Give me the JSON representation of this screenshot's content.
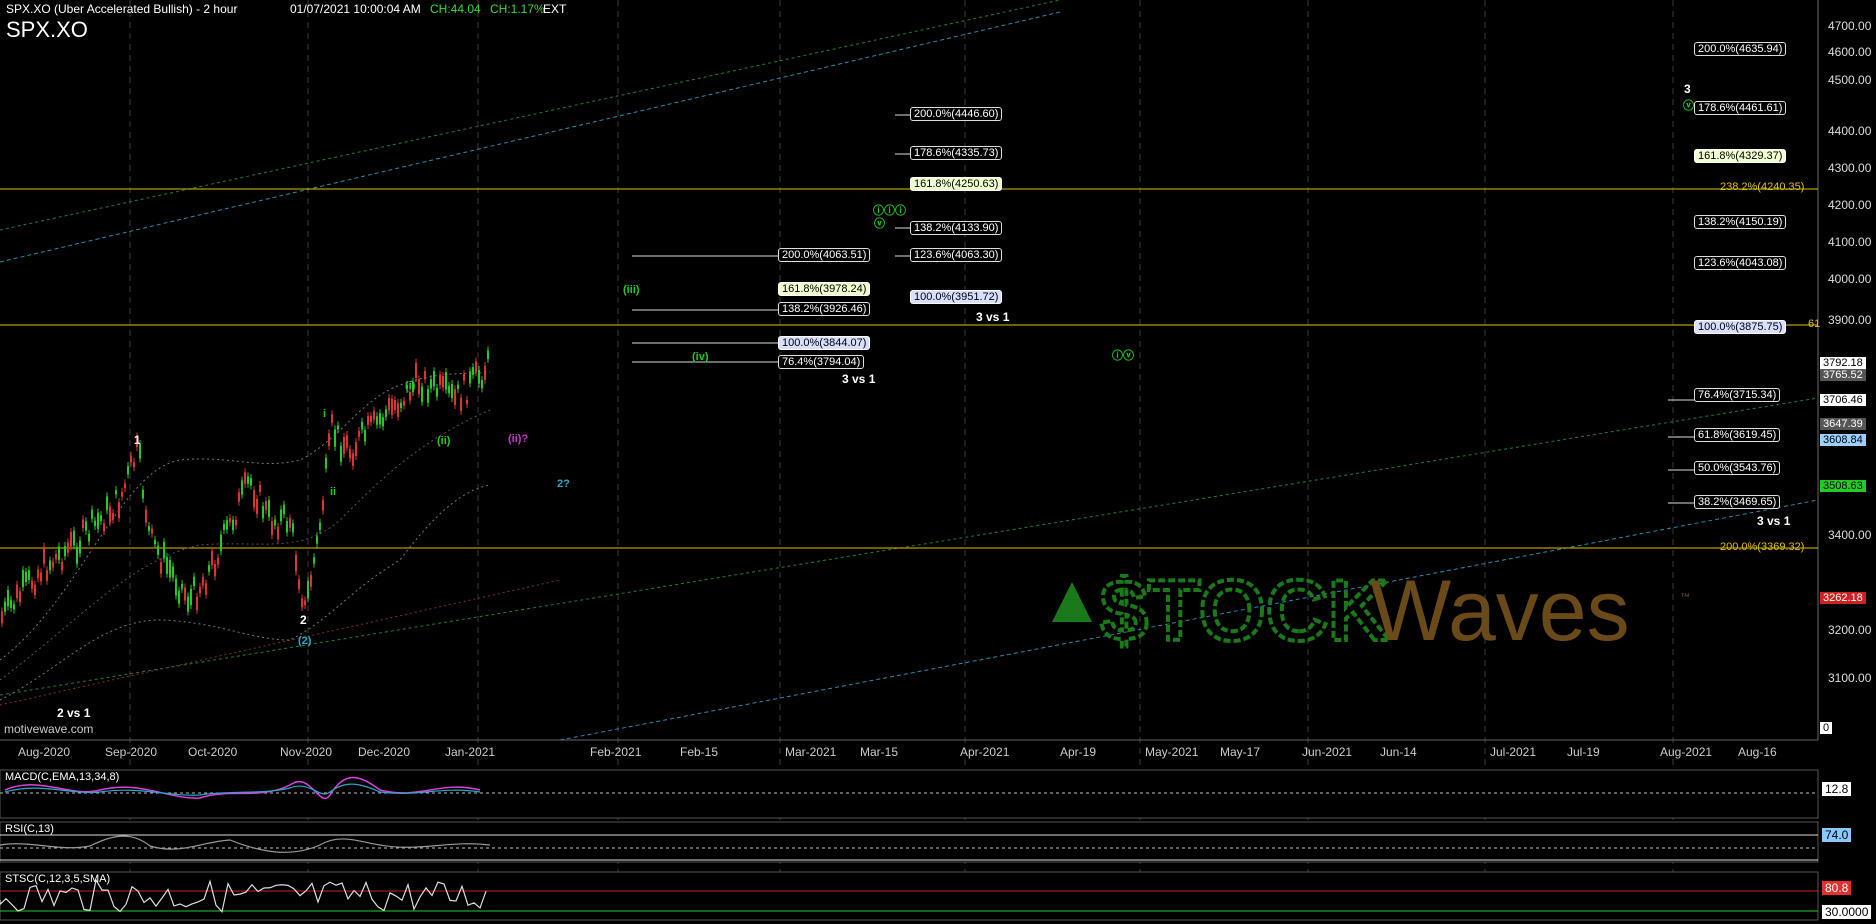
{
  "header": {
    "symbol_large": "SPX.XO",
    "title": "SPX.XO (Uber Accelerated Bullish) - 2 hour",
    "datetime": "01/07/2021 10:00:04 AM",
    "change_points": "CH:44.04",
    "change_pct": "CH:1.17%",
    "session": "EXT"
  },
  "watermark": {
    "text": "motivewave.com"
  },
  "logo": {
    "part1": "$TOCK",
    "part2": "Waves",
    "tm": "™"
  },
  "colors": {
    "grid": "#3a3a3a",
    "yellow": "#e0c000",
    "green": "#22cc22",
    "white": "#ffffff",
    "cyan": "#29a8c8",
    "magenta": "#cc33cc",
    "bg": "#000000"
  },
  "price_axis": {
    "ticks": [
      "4700.00",
      "4600.00",
      "4500.00",
      "4400.00",
      "4300.00",
      "4200.00",
      "4100.00",
      "4000.00",
      "3900.00",
      "3400.00",
      "3200.00",
      "3100.00"
    ],
    "badges": [
      {
        "label": "3792.18",
        "style": "white"
      },
      {
        "label": "3765.52",
        "style": "gray"
      },
      {
        "label": "3706.46",
        "style": "white"
      },
      {
        "label": "3647.39",
        "style": "gray"
      },
      {
        "label": "3608.84",
        "style": "blue"
      },
      {
        "label": "3508.63",
        "style": "green"
      },
      {
        "label": "3262.18",
        "style": "red"
      },
      {
        "label": "0",
        "style": "white"
      }
    ]
  },
  "time_axis": {
    "labels": [
      "Aug-2020",
      "Sep-2020",
      "Oct-2020",
      "Nov-2020",
      "Dec-2020",
      "Jan-2021",
      "Feb-2021",
      "Feb-15",
      "Mar-2021",
      "Mar-15",
      "Apr-2021",
      "Apr-19",
      "May-2021",
      "May-17",
      "Jun-2021",
      "Jun-14",
      "Jul-2021",
      "Jul-19",
      "Aug-2021",
      "Aug-16"
    ]
  },
  "fib_boxes_1": [
    {
      "label": "200.0%(4063.51)",
      "style": "white"
    },
    {
      "label": "161.8%(3978.24)",
      "style": "green"
    },
    {
      "label": "138.2%(3926.46)",
      "style": "white"
    },
    {
      "label": "100.0%(3844.07)",
      "style": "blue"
    },
    {
      "label": "76.4%(3794.04)",
      "style": "white"
    }
  ],
  "fib_boxes_2": [
    {
      "label": "200.0%(4446.60)",
      "style": "white"
    },
    {
      "label": "178.6%(4335.73)",
      "style": "white"
    },
    {
      "label": "161.8%(4250.63)",
      "style": "green"
    },
    {
      "label": "138.2%(4133.90)",
      "style": "white"
    },
    {
      "label": "123.6%(4063.30)",
      "style": "white"
    },
    {
      "label": "100.0%(3951.72)",
      "style": "blue"
    }
  ],
  "fib_boxes_3": [
    {
      "label": "200.0%(4635.94)",
      "style": "white"
    },
    {
      "label": "178.6%(4461.61)",
      "style": "white"
    },
    {
      "label": "161.8%(4329.37)",
      "style": "green"
    },
    {
      "label": "138.2%(4150.19)",
      "style": "white"
    },
    {
      "label": "123.6%(4043.08)",
      "style": "white"
    },
    {
      "label": "100.0%(3875.75)",
      "style": "blue"
    },
    {
      "label": "76.4%(3715.34)",
      "style": "white"
    },
    {
      "label": "61.8%(3619.45)",
      "style": "white"
    },
    {
      "label": "50.0%(3543.76)",
      "style": "white"
    },
    {
      "label": "38.2%(3469.65)",
      "style": "white"
    }
  ],
  "yellow_fib_labels": [
    {
      "label": "238.2%(4240.35)"
    },
    {
      "label": "61"
    },
    {
      "label": "200.0%(3369.32)"
    }
  ],
  "wave_labels": {
    "w1": "1",
    "w2": "2",
    "w2_paren": "(2)",
    "w3": "3",
    "i": "(i)",
    "ii": "(ii)",
    "i_circle": "ⓘ",
    "ii_circle": "ⓘⓘ",
    "i_small": "i",
    "ii_small": "ii",
    "ii_q": "(ii)?",
    "two_q": "2?",
    "iii_circle": "(iii)",
    "iii_top": "ⓘⓘⓘ",
    "v": "ⓥ",
    "iv": "(iv)",
    "iv_circle": "ⓘⓥ",
    "v_circle": "ⓥ"
  },
  "annotations": {
    "a1": "2 vs 1",
    "a2": "3 vs 1",
    "a3": "3 vs 1",
    "a4": "3 vs 1"
  },
  "indicators": {
    "macd_label": "MACD(C,EMA,13,34,8)",
    "macd_value": "12.8",
    "rsi_label": "RSI(C,13)",
    "rsi_value": "74.0",
    "stoch_label": "STSC(C,12,3,5,SMA)",
    "stoch_value_high": "80.8",
    "stoch_value_low": "30.0000"
  }
}
